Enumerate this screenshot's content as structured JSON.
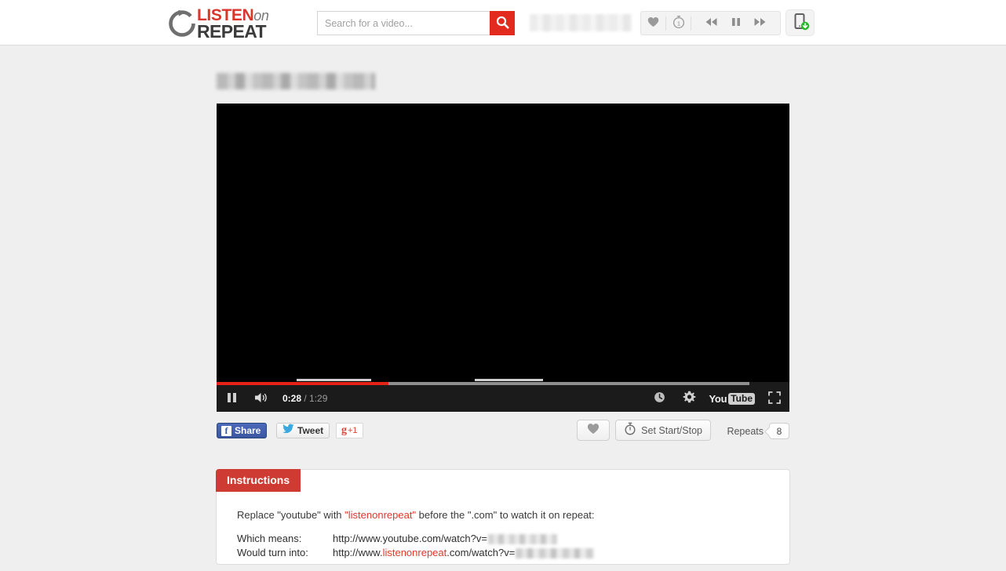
{
  "header": {
    "logo": {
      "line1_main": "LISTEN",
      "line1_suffix": "on",
      "line2": "REPEAT",
      "red": "#d9362c",
      "dark": "#3b3b3b"
    },
    "search": {
      "placeholder": "Search for a video...",
      "value": "",
      "button_color": "#e22b1e"
    },
    "now_playing_redacted": "",
    "controls": {
      "favorite": "",
      "repeat_count_badge": "1",
      "previous": "",
      "pause": "",
      "next": ""
    },
    "mobile_app_button": ""
  },
  "main": {
    "video_title_redacted": "",
    "player": {
      "current_time": "0:28",
      "time_separator": "/",
      "total_time": "1:29",
      "progress_played_percent": 30,
      "progress_loaded_percent": 93,
      "youtube_logo_part1": "You",
      "youtube_logo_part2": "Tube",
      "accent_red": "#e62117",
      "bar_bg": "#1b1b1b"
    },
    "actions": {
      "facebook_icon": "f",
      "facebook_label": "Share",
      "twitter_label": "Tweet",
      "google_g": "g",
      "google_plus": "+1",
      "favorite_label": "",
      "set_start_stop_label": "Set Start/Stop",
      "repeats_label": "Repeats",
      "repeats_count": "8"
    },
    "instructions": {
      "tab_title": "Instructions",
      "lead_part1": "Replace \"youtube\" with ",
      "lead_highlight": "\"listenonrepeat\"",
      "lead_part2": " before the \".com\" to watch it on repeat:",
      "row1_label": "Which means:",
      "row1_url_prefix": "http://www.youtube.com/watch?v=",
      "row2_label": "Would turn into:",
      "row2_url_part1": "http://www.",
      "row2_url_highlight": "listenonrepeat",
      "row2_url_part2": ".com/watch?v=",
      "highlight_color": "#e0392c",
      "tab_color": "#cd3b32"
    }
  }
}
